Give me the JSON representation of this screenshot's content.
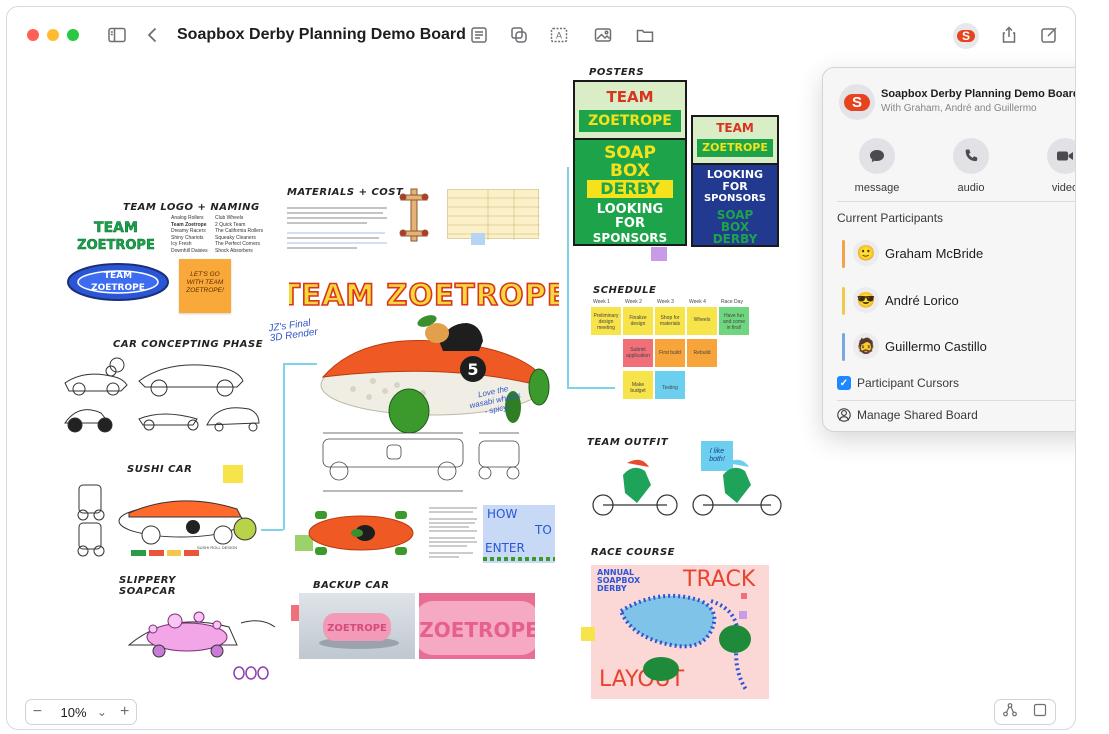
{
  "window": {
    "title": "Soapbox Derby Planning Demo Board",
    "traffic_lights": [
      "#ff5f57",
      "#febc2e",
      "#28c840"
    ]
  },
  "toolbar": {
    "left_icons": [
      "sidebar-toggle-icon",
      "back-chevron-icon"
    ],
    "center_icons": [
      "note-icon",
      "shapes-icon",
      "text-box-icon",
      "media-icon",
      "folder-icon"
    ],
    "right_icons": [
      "collaborator-avatar",
      "share-icon",
      "compose-icon"
    ],
    "avatar_letter": "S"
  },
  "board": {
    "sections": {
      "team_logo": "TEAM LOGO + NAMING",
      "materials": "MATERIALS + COST",
      "posters": "POSTERS",
      "car_concept": "CAR CONCEPTING PHASE",
      "sushi_car": "SUSHI CAR",
      "slippery": "SLIPPERY\nSOAPCAR",
      "backup_car": "BACKUP CAR",
      "schedule": "SCHEDULE",
      "team_outfit": "TEAM OUTFIT",
      "race_course": "RACE COURSE"
    },
    "logo_text": [
      "TEAM",
      "ZOETROPE"
    ],
    "ring_logo": [
      "TEAM",
      "ZOETROPE"
    ],
    "sticky_notes": {
      "gets_go": "LET'S GO\nWITH TEAM\nZOETROPE!",
      "i_like_both": "I like\nboth!"
    },
    "team_names_left": [
      "Analog Rollers",
      "Team Zoetrope",
      "Dreamy Racers",
      "Shiny Chariots",
      "Icy Fresh",
      "Downhill Daisies"
    ],
    "team_names_right": [
      "Club Wheels",
      "2 Quick Team",
      "The California Rollers",
      "Squeaky Cleaners",
      "The Perfect Corners",
      "Shock Absorbers"
    ],
    "banner": "TEAM ZOETROPE",
    "render_note": "JZ's Final\n3D Render",
    "wasabi_note": "Love the\nwasabi wheels\n- spicy!",
    "car_number": "5",
    "poster_main": {
      "top": [
        "TEAM",
        "ZOETROPE"
      ],
      "middle": [
        "SOAP",
        "BOX",
        "DERBY"
      ],
      "bottom": [
        "LOOKING",
        "FOR",
        "SPONSORS"
      ]
    },
    "poster_alt": {
      "top": [
        "TEAM",
        "ZOETROPE"
      ],
      "middle": [
        "LOOKING",
        "FOR",
        "SPONSORS"
      ],
      "bottom": [
        "SOAP",
        "BOX",
        "DERBY"
      ]
    },
    "schedule": {
      "weeks": [
        "Week 1",
        "Week 2",
        "Week 3",
        "Week 4",
        "Race Day"
      ],
      "tasks": [
        "Preliminary design meeting",
        "Finalize design",
        "Shop for materials",
        "Wheels",
        "Have fun and come in first!",
        "Submit application",
        "First build",
        "Rebuild",
        "Make budget",
        "Testing"
      ]
    },
    "how_to_enter": [
      "HOW",
      "TO",
      "ENTER"
    ],
    "backup_car_text": "ZOETROPE",
    "track": {
      "title_left": [
        "ANNUAL",
        "SOAPBOX",
        "DERBY"
      ],
      "title_right": "TRACK",
      "subtitle": "LAYOUT"
    }
  },
  "zoom": {
    "value": "10%",
    "minus": "−",
    "plus": "+",
    "chevron": "⌄"
  },
  "popover": {
    "title": "Soapbox Derby Planning Demo Board",
    "subtitle": "With Graham, André and Guillermo",
    "avatar_letter": "S",
    "actions": [
      {
        "label": "message",
        "icon": "message-bubble-icon"
      },
      {
        "label": "audio",
        "icon": "phone-icon"
      },
      {
        "label": "video",
        "icon": "video-camera-icon"
      }
    ],
    "participants_heading": "Current Participants",
    "participants": [
      {
        "name": "Graham McBride",
        "color": "#f4a14a",
        "emoji": "🙂"
      },
      {
        "name": "André Lorico",
        "color": "#f2c94c",
        "emoji": "😎"
      },
      {
        "name": "Guillermo Castillo",
        "color": "#7aa7e0",
        "emoji": "🧔"
      }
    ],
    "cursors_label": "Participant Cursors",
    "cursors_checked": true,
    "manage_label": "Manage Shared Board"
  },
  "colors": {
    "accent_blue": "#1f87ff",
    "brand_orange": "#e8431f",
    "poster_green": "#1da34a",
    "poster_yellow": "#f5e21b",
    "poster_navy": "#213a8f"
  }
}
